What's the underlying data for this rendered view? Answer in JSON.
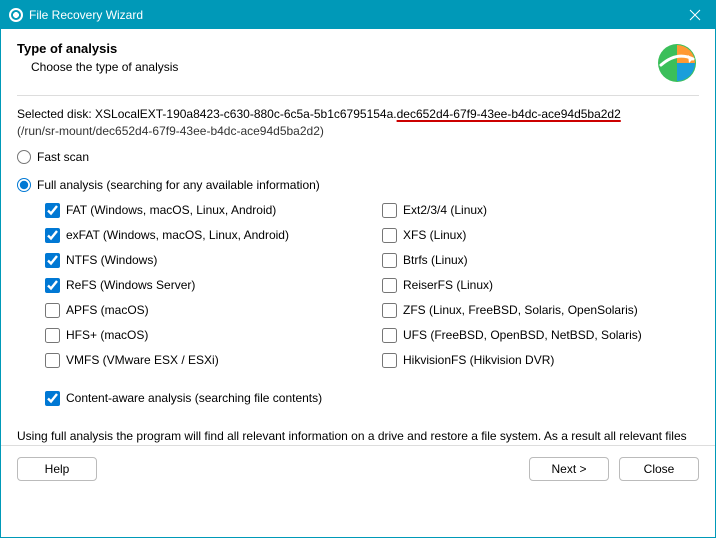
{
  "titlebar": {
    "title": "File Recovery Wizard"
  },
  "header": {
    "title": "Type of analysis",
    "subtitle": "Choose the type of analysis"
  },
  "disk": {
    "prefix": "Selected disk: XSLocalEXT-190a8423-c630-880c-6c5a-5b1c6795154a.",
    "underlined": "dec652d4-67f9-43ee-b4dc-ace94d5ba2d2",
    "path": "(/run/sr-mount/dec652d4-67f9-43ee-b4dc-ace94d5ba2d2)"
  },
  "options": {
    "fast": {
      "label": "Fast scan",
      "checked": false
    },
    "full": {
      "label": "Full analysis (searching for any available information)",
      "checked": true
    }
  },
  "filesystems": [
    {
      "label": "FAT (Windows, macOS, Linux, Android)",
      "checked": true
    },
    {
      "label": "Ext2/3/4 (Linux)",
      "checked": false
    },
    {
      "label": "exFAT (Windows, macOS, Linux, Android)",
      "checked": true
    },
    {
      "label": "XFS (Linux)",
      "checked": false
    },
    {
      "label": "NTFS (Windows)",
      "checked": true
    },
    {
      "label": "Btrfs (Linux)",
      "checked": false
    },
    {
      "label": "ReFS (Windows Server)",
      "checked": true
    },
    {
      "label": "ReiserFS (Linux)",
      "checked": false
    },
    {
      "label": "APFS (macOS)",
      "checked": false
    },
    {
      "label": "ZFS (Linux, FreeBSD, Solaris, OpenSolaris)",
      "checked": false
    },
    {
      "label": "HFS+ (macOS)",
      "checked": false
    },
    {
      "label": "UFS (FreeBSD, OpenBSD, NetBSD, Solaris)",
      "checked": false
    },
    {
      "label": "VMFS (VMware ESX / ESXi)",
      "checked": false
    },
    {
      "label": "HikvisionFS (Hikvision DVR)",
      "checked": false
    }
  ],
  "content_aware": {
    "label": "Content-aware analysis (searching file contents)",
    "checked": true
  },
  "description": "Using full analysis the program will find all relevant information on a drive and restore a file system. As a result all relevant files will be restored.",
  "buttons": {
    "help": "Help",
    "next": "Next >",
    "close": "Close"
  }
}
